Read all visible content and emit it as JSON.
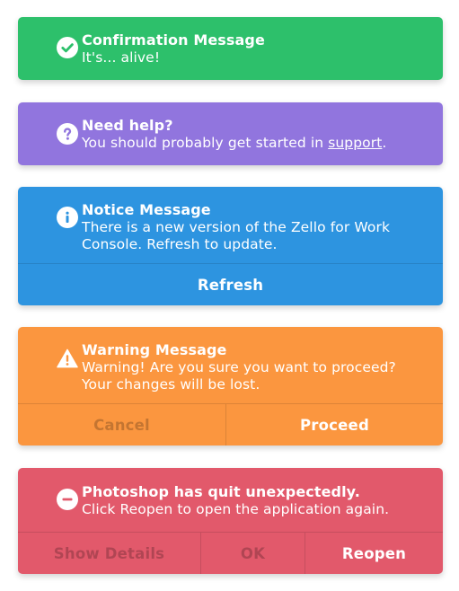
{
  "colors": {
    "success": "#2dc06b",
    "help": "#9175de",
    "notice": "#2d94e0",
    "warning": "#fb963f",
    "error": "#e2596b"
  },
  "confirmation": {
    "icon": "check-circle-icon",
    "title": "Confirmation Message",
    "text": "It's... alive!"
  },
  "help": {
    "icon": "question-circle-icon",
    "title": "Need help?",
    "text_before": "You should probably get started in ",
    "link": "support",
    "text_after": "."
  },
  "notice": {
    "icon": "info-circle-icon",
    "title": "Notice Message",
    "text": "There is a new version of the Zello for Work Console. Refresh to update.",
    "refresh_label": "Refresh"
  },
  "warning": {
    "icon": "warning-triangle-icon",
    "title": "Warning Message",
    "text": "Warning! Are you sure you want to proceed? Your changes will be lost.",
    "cancel_label": "Cancel",
    "proceed_label": "Proceed"
  },
  "error": {
    "icon": "minus-circle-icon",
    "title": "Photoshop has quit unexpectedly.",
    "text": "Click Reopen to open the application again.",
    "details_label": "Show Details",
    "ok_label": "OK",
    "reopen_label": "Reopen"
  }
}
